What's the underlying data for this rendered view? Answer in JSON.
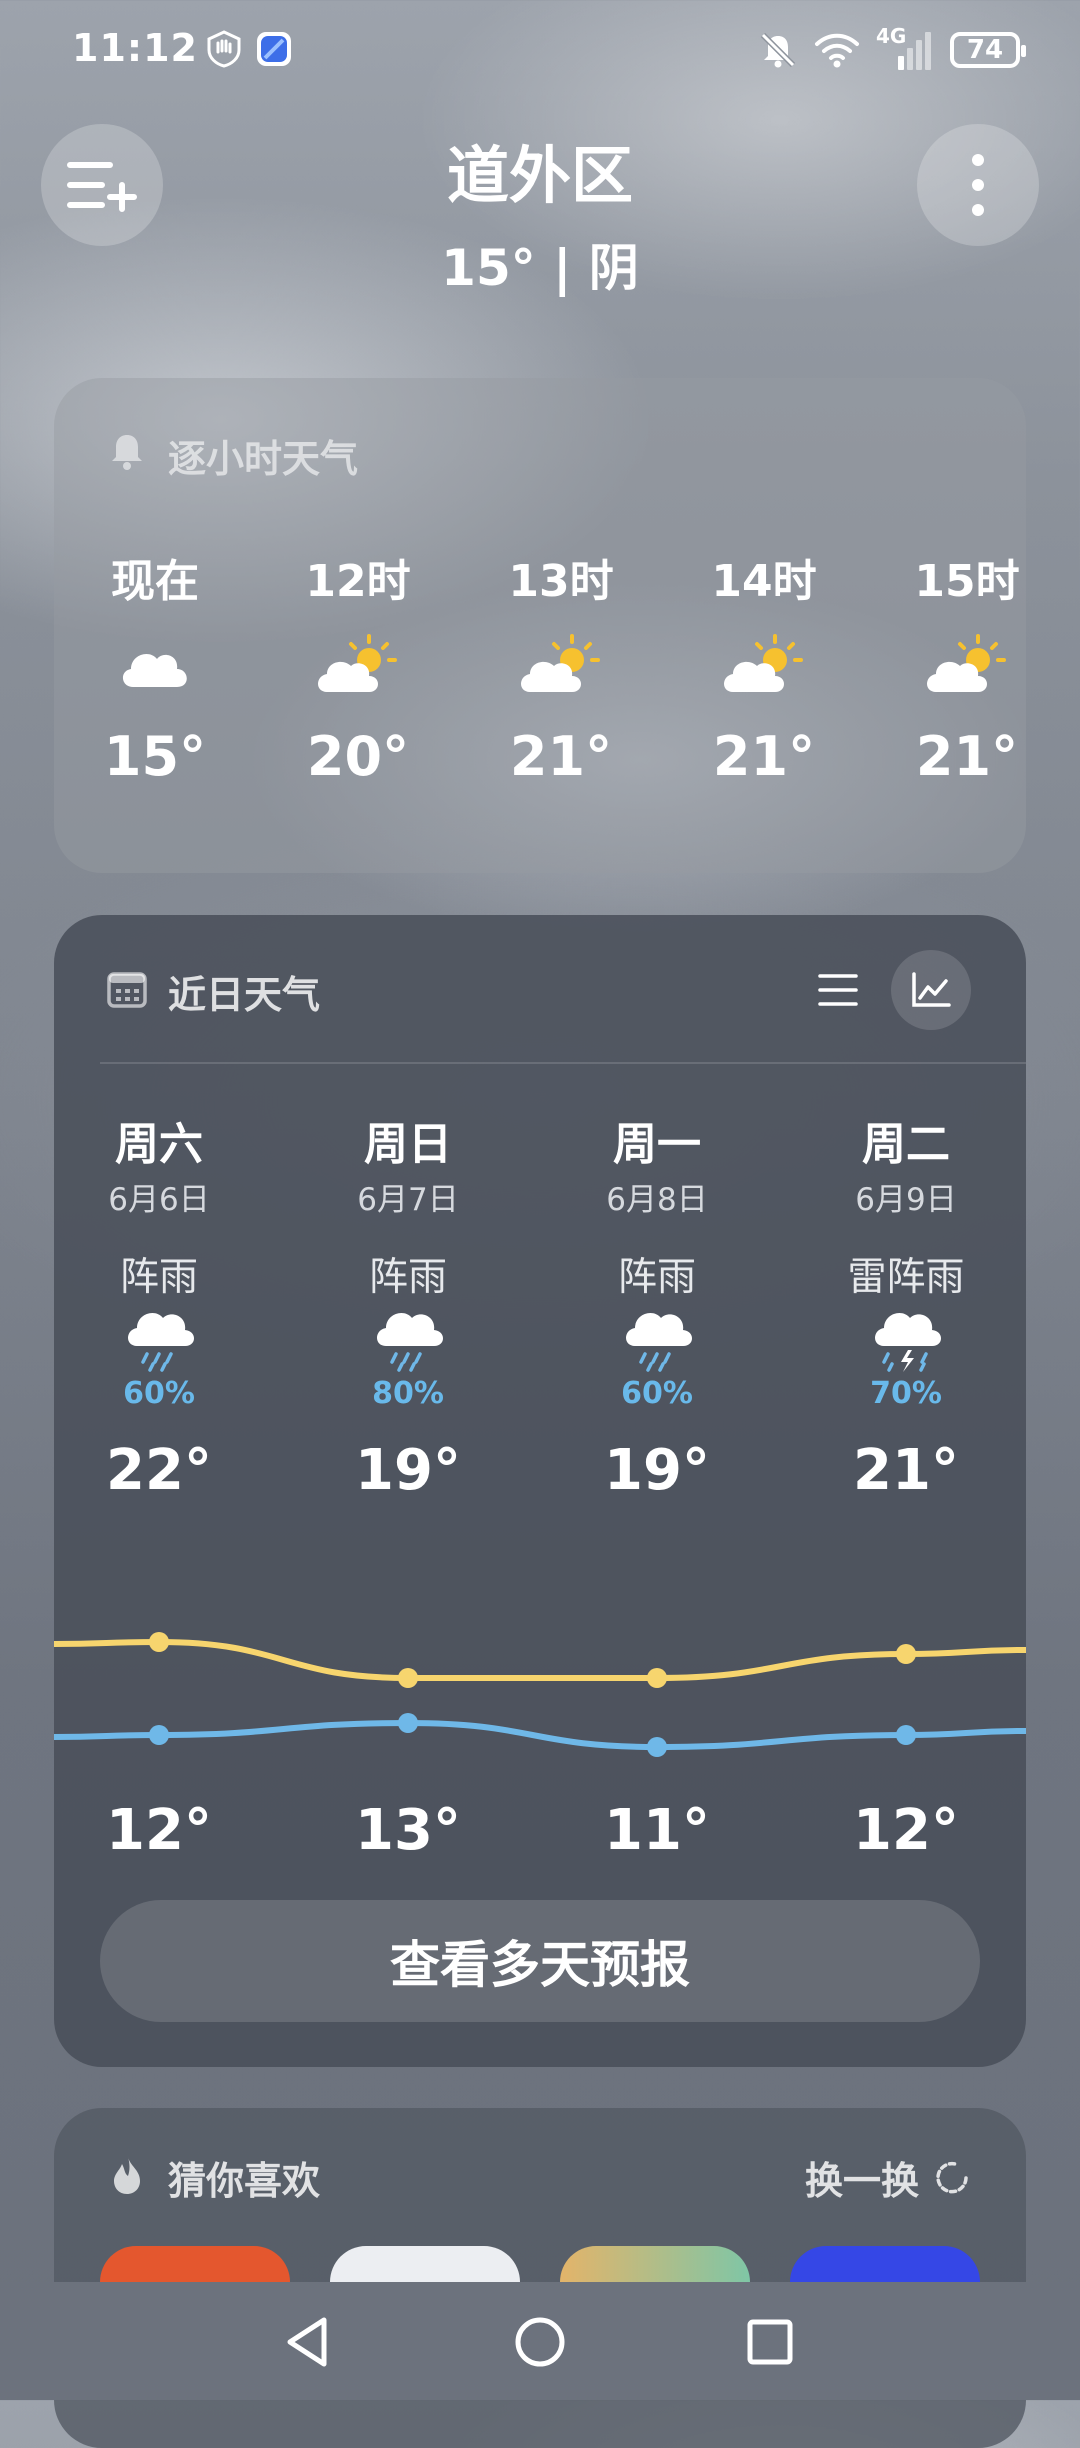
{
  "status_bar": {
    "time": "11:12",
    "icons": [
      "hand-shield-icon",
      "app-badge-icon",
      "mute-bell-icon",
      "wifi-icon",
      "signal-4g-icon",
      "battery-icon"
    ],
    "network": "4G",
    "battery": "74"
  },
  "header": {
    "city": "道外区",
    "current": "15° | 阴"
  },
  "hourly": {
    "title": "逐小时天气",
    "items": [
      {
        "time": "现在",
        "icon": "cloudy-icon",
        "temp": "15°"
      },
      {
        "time": "12时",
        "icon": "partly-sunny-icon",
        "temp": "20°"
      },
      {
        "time": "13时",
        "icon": "partly-sunny-icon",
        "temp": "21°"
      },
      {
        "time": "14时",
        "icon": "partly-sunny-icon",
        "temp": "21°"
      },
      {
        "time": "15时",
        "icon": "partly-sunny-icon",
        "temp": "21°"
      }
    ]
  },
  "daily": {
    "title": "近日天气",
    "days": [
      {
        "weekday": "周六",
        "date": "6月6日",
        "condition": "阵雨",
        "icon": "rain-icon",
        "pop": "60%",
        "high": "22°",
        "low": "12°"
      },
      {
        "weekday": "周日",
        "date": "6月7日",
        "condition": "阵雨",
        "icon": "rain-icon",
        "pop": "80%",
        "high": "19°",
        "low": "13°"
      },
      {
        "weekday": "周一",
        "date": "6月8日",
        "condition": "阵雨",
        "icon": "rain-icon",
        "pop": "60%",
        "high": "19°",
        "low": "11°"
      },
      {
        "weekday": "周二",
        "date": "6月9日",
        "condition": "雷阵雨",
        "icon": "thunderstorm-icon",
        "pop": "70%",
        "high": "21°",
        "low": "12°"
      }
    ],
    "more_button": "查看多天预报"
  },
  "chart_data": {
    "type": "line",
    "categories": [
      "周六",
      "周日",
      "周一",
      "周二"
    ],
    "series": [
      {
        "values": [
          22,
          19,
          19,
          21
        ]
      },
      {
        "values": [
          12,
          13,
          11,
          12
        ]
      }
    ]
  },
  "recommend": {
    "title": "猜你喜欢",
    "refresh": "换一换"
  },
  "colors": {
    "high_line": "#f7d56e",
    "low_line": "#6fb8e8",
    "pop_text": "#69b9ea",
    "sun": "#f6c12f"
  }
}
